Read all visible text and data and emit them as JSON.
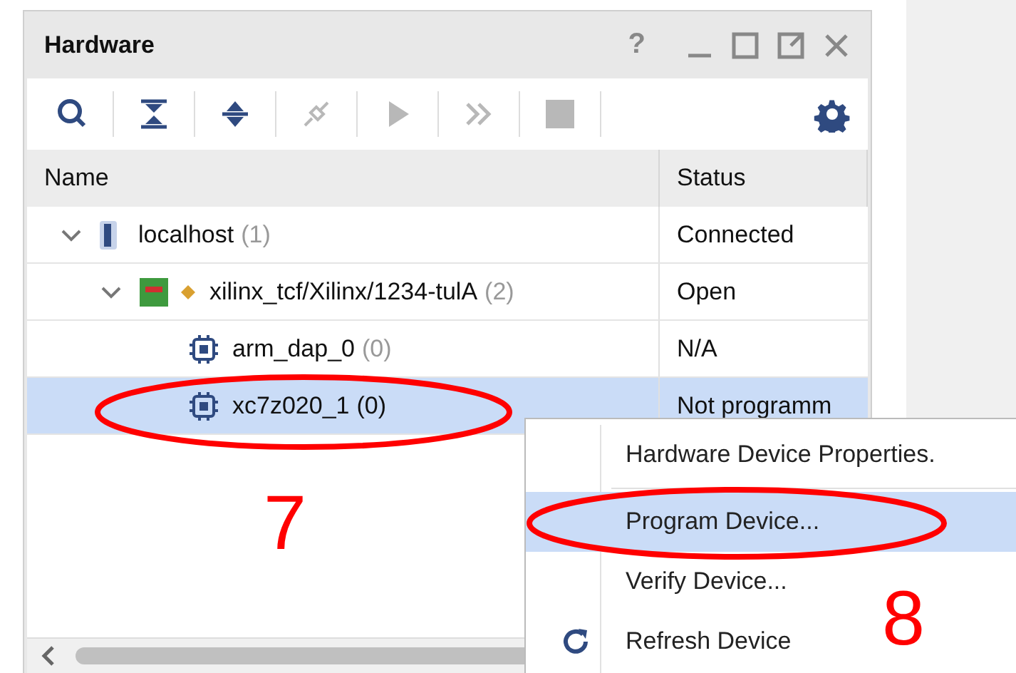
{
  "panel": {
    "title": "Hardware",
    "help": "?",
    "toolbar": [
      {
        "kind": "search",
        "disabled": false
      },
      {
        "kind": "collapse",
        "disabled": false
      },
      {
        "kind": "expand",
        "disabled": false
      },
      {
        "kind": "connect",
        "disabled": true
      },
      {
        "kind": "run",
        "disabled": true
      },
      {
        "kind": "forward",
        "disabled": true
      },
      {
        "kind": "stop",
        "disabled": true
      }
    ],
    "columns": [
      "Name",
      "Status"
    ],
    "tree": [
      {
        "kind": "host",
        "name": "localhost",
        "count": "(1)",
        "status": "Connected",
        "selected": false,
        "expanded": true,
        "children": [
          {
            "kind": "target",
            "name": "xilinx_tcf/Xilinx/1234-tulA",
            "count": "(2)",
            "status": "Open",
            "selected": false,
            "expanded": true,
            "children": [
              {
                "kind": "device",
                "name": "arm_dap_0",
                "count": "(0)",
                "status": "N/A",
                "selected": false
              },
              {
                "kind": "device",
                "name": "xc7z020_1",
                "count": "(0)",
                "status": "Not programm",
                "selected": true
              }
            ]
          }
        ]
      }
    ]
  },
  "context_menu": [
    {
      "kind": "plain",
      "label": "Hardware Device Properties.",
      "selected": false,
      "separator_after": true
    },
    {
      "kind": "plain",
      "label": "Program Device...",
      "selected": true,
      "separator_after": false
    },
    {
      "kind": "plain",
      "label": "Verify Device...",
      "selected": false,
      "separator_after": false
    },
    {
      "kind": "refresh",
      "label": "Refresh Device",
      "selected": false,
      "separator_after": false
    }
  ],
  "annotations": [
    {
      "number": "7"
    },
    {
      "number": "8"
    }
  ]
}
